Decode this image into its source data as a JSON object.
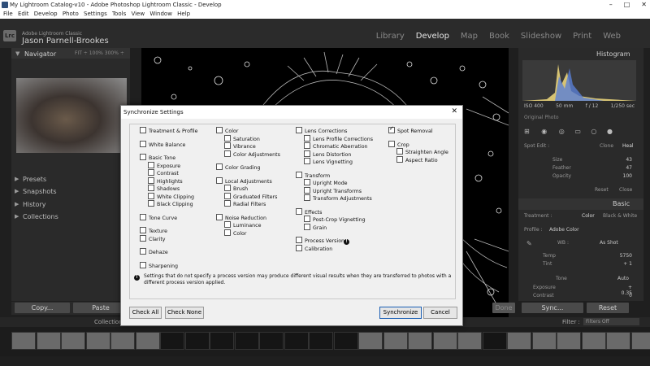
{
  "window": {
    "title": "My Lightroom Catalog-v10 - Adobe Photoshop Lightroom Classic - Develop",
    "controls": [
      "–",
      "□",
      "✕"
    ]
  },
  "menu": [
    "File",
    "Edit",
    "Develop",
    "Photo",
    "Settings",
    "Tools",
    "View",
    "Window",
    "Help"
  ],
  "identity": {
    "logo": "Lrc",
    "app_name": "Adobe Lightroom Classic",
    "user": "Jason Parnell-Brookes"
  },
  "modules": [
    {
      "label": "Library",
      "active": false
    },
    {
      "label": "Develop",
      "active": true
    },
    {
      "label": "Map",
      "active": false
    },
    {
      "label": "Book",
      "active": false
    },
    {
      "label": "Slideshow",
      "active": false
    },
    {
      "label": "Print",
      "active": false
    },
    {
      "label": "Web",
      "active": false
    }
  ],
  "left_panel": {
    "navigator_title": "Navigator",
    "zoom_levels": "FIT ÷ 100% 300% ÷",
    "sections": [
      "Presets",
      "Snapshots",
      "History",
      "Collections"
    ],
    "copy_label": "Copy...",
    "paste_label": "Paste"
  },
  "right_panel": {
    "histogram_title": "Histogram",
    "iso": "ISO 400",
    "focal": "50 mm",
    "aperture": "f / 12",
    "shutter": "1/250 sec",
    "original_photo": "Original Photo",
    "spot_edit": "Spot Edit :",
    "clone": "Clone",
    "heal": "Heal",
    "size_label": "Size",
    "size_value": "43",
    "feather_label": "Feather",
    "feather_value": "47",
    "opacity_label": "Opacity",
    "opacity_value": "100",
    "reset_small": "Reset",
    "close_small": "Close",
    "basic_title": "Basic",
    "treatment_label": "Treatment :",
    "color_label": "Color",
    "bw_label": "Black & White",
    "profile_label": "Profile :",
    "profile_value": "Adobe Color",
    "wb_label": "WB :",
    "wb_value": "As Shot",
    "temp_label": "Temp",
    "temp_value": "5750",
    "tint_label": "Tint",
    "tint_value": "+ 1",
    "tone_label": "Tone",
    "auto_label": "Auto",
    "exposure_label": "Exposure",
    "exposure_value": "+ 0.35",
    "contrast_label": "Contrast",
    "contrast_value": "0",
    "sync_label": "Sync...",
    "reset_label": "Reset",
    "done_label": "Done"
  },
  "filmstrip": {
    "collection_label": "Collection",
    "filter_label": "Filter :",
    "filter_value": "Filters Off"
  },
  "dialog": {
    "title": "Synchronize Settings",
    "close": "✕",
    "col1": [
      {
        "label": "Treatment & Profile",
        "checked": false,
        "indent": false
      },
      {
        "gap": true
      },
      {
        "label": "White Balance",
        "checked": false,
        "indent": false
      },
      {
        "gap": true
      },
      {
        "label": "Basic Tone",
        "checked": false,
        "indent": false
      },
      {
        "label": "Exposure",
        "checked": false,
        "indent": true
      },
      {
        "label": "Contrast",
        "checked": false,
        "indent": true
      },
      {
        "label": "Highlights",
        "checked": false,
        "indent": true
      },
      {
        "label": "Shadows",
        "checked": false,
        "indent": true
      },
      {
        "label": "White Clipping",
        "checked": false,
        "indent": true
      },
      {
        "label": "Black Clipping",
        "checked": false,
        "indent": true
      },
      {
        "gap": true
      },
      {
        "label": "Tone Curve",
        "checked": false,
        "indent": false
      },
      {
        "gap": true
      },
      {
        "label": "Texture",
        "checked": false,
        "indent": false
      },
      {
        "label": "Clarity",
        "checked": false,
        "indent": false
      },
      {
        "gap": true
      },
      {
        "label": "Dehaze",
        "checked": false,
        "indent": false
      },
      {
        "gap": true
      },
      {
        "label": "Sharpening",
        "checked": false,
        "indent": false
      }
    ],
    "col2": [
      {
        "label": "Color",
        "checked": false,
        "indent": false
      },
      {
        "label": "Saturation",
        "checked": false,
        "indent": true
      },
      {
        "label": "Vibrance",
        "checked": false,
        "indent": true
      },
      {
        "label": "Color Adjustments",
        "checked": false,
        "indent": true
      },
      {
        "gap": true
      },
      {
        "label": "Color Grading",
        "checked": false,
        "indent": false
      },
      {
        "gap": true
      },
      {
        "label": "Local Adjustments",
        "checked": false,
        "indent": false
      },
      {
        "label": "Brush",
        "checked": false,
        "indent": true
      },
      {
        "label": "Graduated Filters",
        "checked": false,
        "indent": true
      },
      {
        "label": "Radial Filters",
        "checked": false,
        "indent": true
      },
      {
        "gap": true
      },
      {
        "label": "Noise Reduction",
        "checked": false,
        "indent": false
      },
      {
        "label": "Luminance",
        "checked": false,
        "indent": true
      },
      {
        "label": "Color",
        "checked": false,
        "indent": true
      }
    ],
    "col3": [
      {
        "label": "Lens Corrections",
        "checked": false,
        "indent": false
      },
      {
        "label": "Lens Profile Corrections",
        "checked": false,
        "indent": true
      },
      {
        "label": "Chromatic Aberration",
        "checked": false,
        "indent": true
      },
      {
        "label": "Lens Distortion",
        "checked": false,
        "indent": true
      },
      {
        "label": "Lens Vignetting",
        "checked": false,
        "indent": true
      },
      {
        "gap": true
      },
      {
        "label": "Transform",
        "checked": false,
        "indent": false
      },
      {
        "label": "Upright Mode",
        "checked": false,
        "indent": true
      },
      {
        "label": "Upright Transforms",
        "checked": false,
        "indent": true
      },
      {
        "label": "Transform Adjustments",
        "checked": false,
        "indent": true
      },
      {
        "gap": true
      },
      {
        "label": "Effects",
        "checked": false,
        "indent": false
      },
      {
        "label": "Post-Crop Vignetting",
        "checked": false,
        "indent": true
      },
      {
        "label": "Grain",
        "checked": false,
        "indent": true
      },
      {
        "gap": true
      },
      {
        "label": "Process Version",
        "checked": false,
        "indent": false
      },
      {
        "label": "Calibration",
        "checked": false,
        "indent": false
      }
    ],
    "col4": [
      {
        "label": "Spot Removal",
        "checked": true,
        "indent": false
      },
      {
        "gap": true
      },
      {
        "label": "Crop",
        "checked": false,
        "indent": false
      },
      {
        "label": "Straighten Angle",
        "checked": false,
        "indent": true
      },
      {
        "label": "Aspect Ratio",
        "checked": false,
        "indent": true
      }
    ],
    "warning_text": "Settings that do not specify a process version may produce different visual results when they are transferred to photos with a different process version applied.",
    "check_all": "Check All",
    "check_none": "Check None",
    "synchronize": "Synchronize",
    "cancel": "Cancel"
  }
}
